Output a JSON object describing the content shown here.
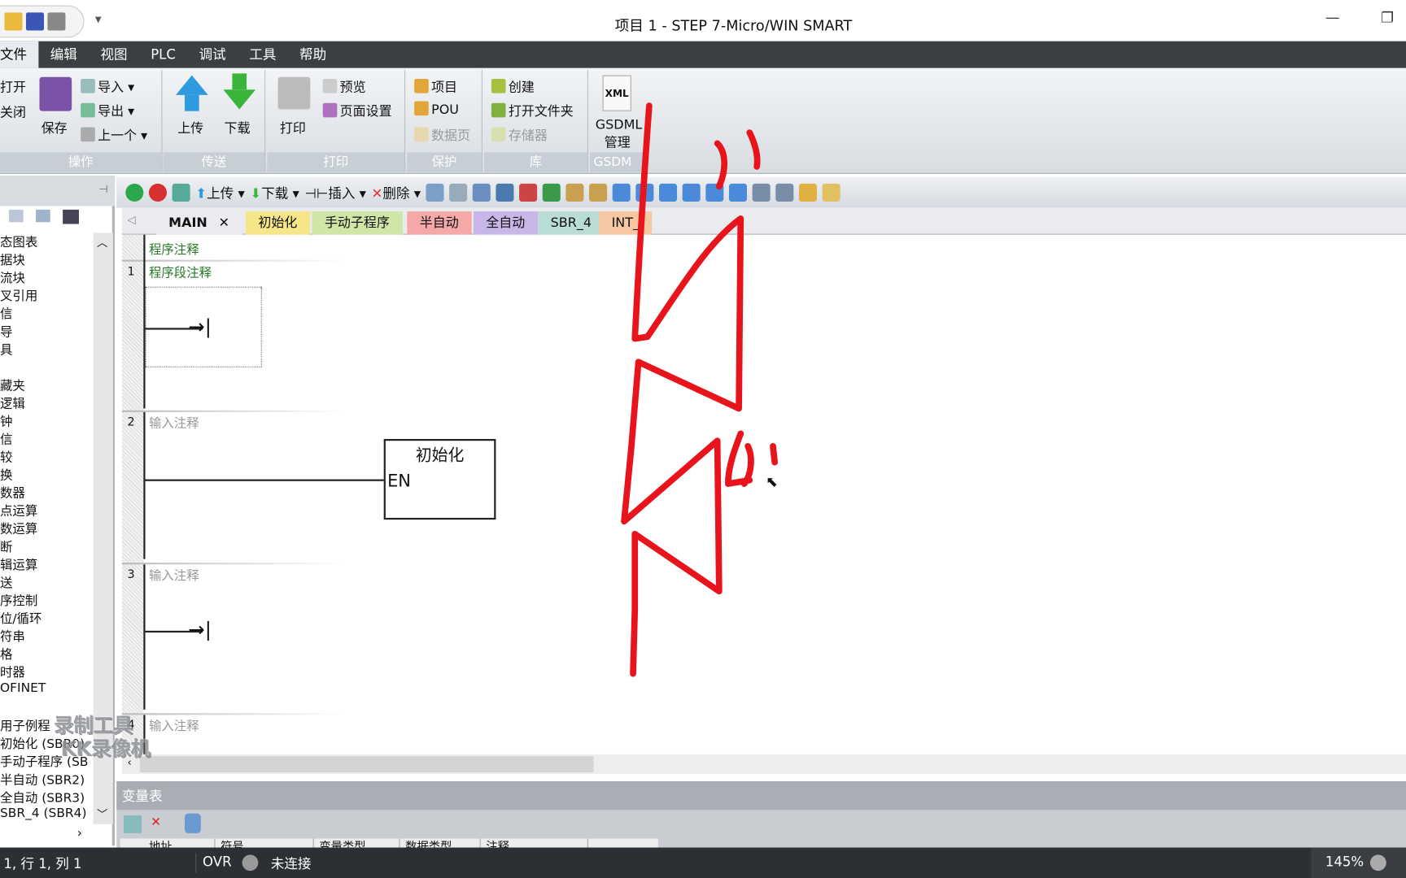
{
  "window": {
    "title": "项目 1 - STEP 7-Micro/WIN SMART",
    "minimize": "—",
    "restore": "❐"
  },
  "menu": [
    "文件",
    "编辑",
    "视图",
    "PLC",
    "调试",
    "工具",
    "帮助"
  ],
  "ribbon": {
    "operate": {
      "label": "操作",
      "open": "打开",
      "close": "关闭",
      "save": "保存",
      "import": "导入",
      "export": "导出",
      "prev": "上一个"
    },
    "transfer": {
      "label": "传送",
      "upload": "上传",
      "download": "下载"
    },
    "print": {
      "label": "打印",
      "print": "打印",
      "preview": "预览",
      "page_setup": "页面设置"
    },
    "protect": {
      "label": "保护",
      "project": "项目",
      "pou": "POU",
      "datapage": "数据页"
    },
    "library": {
      "label": "库",
      "create": "创建",
      "open_folder": "打开文件夹",
      "storage": "存储器"
    },
    "gsdml": {
      "label": "GSDM",
      "xml": "XML",
      "manage1": "GSDML",
      "manage2": "管理"
    }
  },
  "toolbar2": {
    "upload": "上传",
    "download": "下载",
    "insert": "插入",
    "delete": "删除"
  },
  "tree": [
    "态图表",
    "据块",
    "流块",
    "叉引用",
    "信",
    "导",
    "具",
    "",
    "藏夹",
    "逻辑",
    "钟",
    "信",
    "较",
    "换",
    "数器",
    "点运算",
    "数运算",
    "断",
    "辑运算",
    "送",
    "序控制",
    "位/循环",
    "符串",
    "格",
    "时器",
    "OFINET",
    "",
    "用子例程",
    " 初始化 (SBR0)",
    " 手动子程序 (SB",
    " 半自动 (SBR2)",
    " 全自动 (SBR3)",
    " SBR_4 (SBR4)"
  ],
  "tabs": [
    {
      "label": "MAIN",
      "color": "#e9ebee"
    },
    {
      "label": "初始化",
      "color": "#f7e58a"
    },
    {
      "label": "手动子程序",
      "color": "#cfe6a6"
    },
    {
      "label": "半自动",
      "color": "#f4a8a8"
    },
    {
      "label": "全自动",
      "color": "#c9b6e8"
    },
    {
      "label": "SBR_4",
      "color": "#b9dcd4"
    },
    {
      "label": "INT_",
      "color": "#f6c7a2"
    }
  ],
  "editor": {
    "program_comment": "程序注释",
    "networks": [
      {
        "num": "1",
        "comment": "程序段注释"
      },
      {
        "num": "2",
        "comment": "输入注释",
        "box_title": "初始化",
        "box_pin": "EN"
      },
      {
        "num": "3",
        "comment": "输入注释"
      },
      {
        "num": "4",
        "comment": "输入注释"
      }
    ]
  },
  "var_table": {
    "title": "变量表",
    "columns": [
      "地址",
      "符号",
      "变量类型",
      "数据类型",
      "注释"
    ]
  },
  "status": {
    "position": "1, 行 1, 列 1",
    "mode": "OVR",
    "connection": "未连接",
    "zoom": "145%"
  },
  "watermark": "录制工具 KK录像机",
  "colors": {
    "annotation": "#e8141c",
    "menubar": "#3c3f41",
    "statusbar": "#2c2f33"
  }
}
